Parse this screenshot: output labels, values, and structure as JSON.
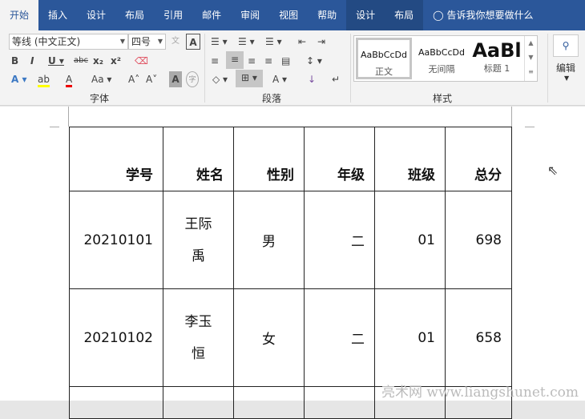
{
  "tabs": [
    "开始",
    "插入",
    "设计",
    "布局",
    "引用",
    "邮件",
    "审阅",
    "视图",
    "帮助",
    "设计",
    "布局"
  ],
  "tell_me": "告诉我你想要做什么",
  "font": {
    "name": "等线 (中文正文)",
    "size": "四号",
    "group": "字体"
  },
  "paragraph": {
    "group": "段落"
  },
  "styles": {
    "group": "样式",
    "items": [
      {
        "sample": "AaBbCcDd",
        "name": "正文"
      },
      {
        "sample": "AaBbCcDd",
        "name": "无间隔"
      },
      {
        "sample": "AaBl",
        "name": "标题 1"
      }
    ]
  },
  "editing": {
    "label": "编辑"
  },
  "table": {
    "headers": [
      "学号",
      "姓名",
      "性别",
      "年级",
      "班级",
      "总分"
    ],
    "rows": [
      {
        "id": "20210101",
        "name1": "王际",
        "name2": "禹",
        "gender": "男",
        "grade": "二",
        "class": "01",
        "total": "698"
      },
      {
        "id": "20210102",
        "name1": "李玉",
        "name2": "恒",
        "gender": "女",
        "grade": "二",
        "class": "01",
        "total": "658"
      }
    ]
  },
  "watermark": "亮术网 www.liangshunet.com"
}
